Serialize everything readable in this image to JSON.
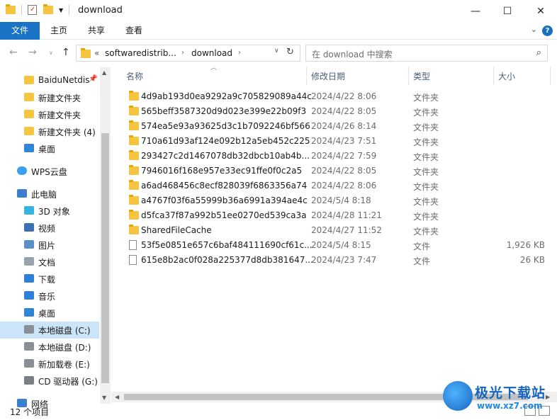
{
  "window": {
    "title": "download",
    "minimize": "—",
    "maximize": "☐",
    "close": "✕"
  },
  "ribbon": {
    "tabs": [
      "文件",
      "主页",
      "共享",
      "查看"
    ],
    "help": "?"
  },
  "address": {
    "crumbs": [
      "softwaredistrib...",
      "download"
    ],
    "overflow": "«",
    "search_placeholder": "在 download 中搜索"
  },
  "nav": {
    "items": [
      {
        "label": "BaiduNetdis",
        "icon": "folder-icon",
        "pinned": true
      },
      {
        "label": "新建文件夹",
        "icon": "folder-icon"
      },
      {
        "label": "新建文件夹",
        "icon": "folder-icon"
      },
      {
        "label": "新建文件夹 (4)",
        "icon": "folder-icon"
      },
      {
        "label": "桌面",
        "icon": "desktop-icon"
      },
      {
        "label": "WPS云盘",
        "icon": "cloud-icon"
      },
      {
        "label": "此电脑",
        "icon": "computer-icon"
      },
      {
        "label": "3D 对象",
        "icon": "cube-icon"
      },
      {
        "label": "视频",
        "icon": "video-icon"
      },
      {
        "label": "图片",
        "icon": "picture-icon"
      },
      {
        "label": "文档",
        "icon": "document-icon"
      },
      {
        "label": "下载",
        "icon": "download-arrow-icon"
      },
      {
        "label": "音乐",
        "icon": "music-note-icon"
      },
      {
        "label": "桌面",
        "icon": "desktop-icon"
      },
      {
        "label": "本地磁盘 (C:)",
        "icon": "drive-icon",
        "selected": true
      },
      {
        "label": "本地磁盘 (D:)",
        "icon": "drive-icon"
      },
      {
        "label": "新加载卷 (E:)",
        "icon": "drive-icon"
      },
      {
        "label": "CD 驱动器 (G:)",
        "icon": "cd-drive-icon"
      },
      {
        "label": "网络",
        "icon": "network-icon"
      }
    ]
  },
  "columns": {
    "name": "名称",
    "date": "修改日期",
    "type": "类型",
    "size": "大小"
  },
  "files": [
    {
      "name": "4d9ab193d0ea9292a9c705829089a44c",
      "date": "2024/4/22 8:06",
      "type": "文件夹",
      "size": "",
      "kind": "folder"
    },
    {
      "name": "565beff3587320d9d023e399e22b09f3",
      "date": "2024/4/22 8:05",
      "type": "文件夹",
      "size": "",
      "kind": "folder"
    },
    {
      "name": "574ea5e93a93625d3c1b7092246bf566",
      "date": "2024/4/26 8:14",
      "type": "文件夹",
      "size": "",
      "kind": "folder"
    },
    {
      "name": "710a61d93af124e092b12a5eb452c225",
      "date": "2024/4/23 7:51",
      "type": "文件夹",
      "size": "",
      "kind": "folder"
    },
    {
      "name": "293427c2d1467078db32dbcb10ab4b...",
      "date": "2024/4/22 7:59",
      "type": "文件夹",
      "size": "",
      "kind": "folder"
    },
    {
      "name": "7946016f168e957e33ec91ffe0f0c2a5",
      "date": "2024/4/22 8:05",
      "type": "文件夹",
      "size": "",
      "kind": "folder"
    },
    {
      "name": "a6ad468456c8ecf828039f6863356a74",
      "date": "2024/4/22 8:06",
      "type": "文件夹",
      "size": "",
      "kind": "folder"
    },
    {
      "name": "a4767f03f6a55999b36a6991a394ae4c",
      "date": "2024/5/4 8:18",
      "type": "文件夹",
      "size": "",
      "kind": "folder"
    },
    {
      "name": "d5fca37f87a992b51ee0270ed539ca3a",
      "date": "2024/4/28 11:21",
      "type": "文件夹",
      "size": "",
      "kind": "folder"
    },
    {
      "name": "SharedFileCache",
      "date": "2024/4/27 11:52",
      "type": "文件夹",
      "size": "",
      "kind": "folder"
    },
    {
      "name": "53f5e0851e657c6baf484111690cf61c...",
      "date": "2024/5/4 8:15",
      "type": "文件",
      "size": "1,926 KB",
      "kind": "file"
    },
    {
      "name": "615e8b2ac0f028a225377d8db381647...",
      "date": "2024/4/23 7:47",
      "type": "文件",
      "size": "26 KB",
      "kind": "file"
    }
  ],
  "status": {
    "count": "12 个项目"
  },
  "watermark": {
    "brand": "极光下载站",
    "url": "www.xz7.com"
  }
}
